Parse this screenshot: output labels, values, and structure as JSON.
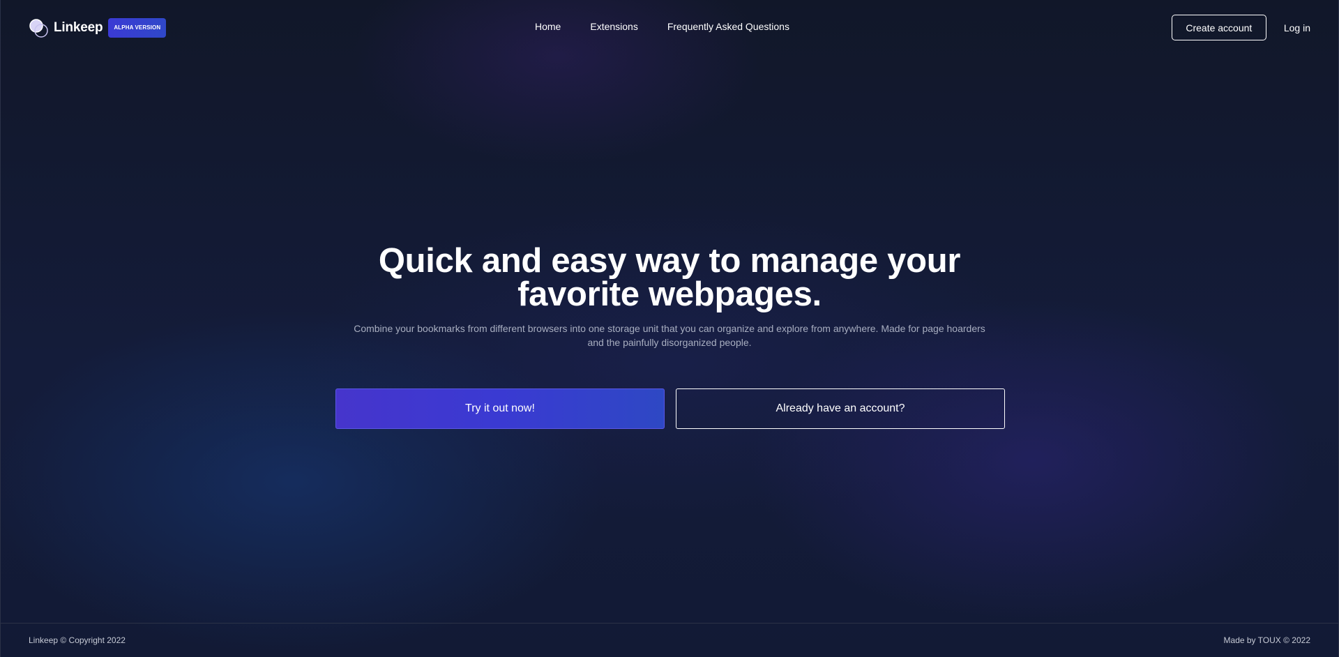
{
  "header": {
    "brand_name": "Linkeep",
    "badge": "ALPHA VERSION",
    "logo_icon": "linked-circles-icon",
    "nav": {
      "home": "Home",
      "extensions": "Extensions",
      "faq": "Frequently Asked Questions"
    },
    "create_account": "Create account",
    "login": "Log in"
  },
  "hero": {
    "title_line1": "Quick and easy way to manage your",
    "title_line2": "favorite webpages.",
    "subtitle": "Combine your bookmarks from different browsers into one storage unit that you can organize and explore from anywhere. Made for page hoarders and the painfully disorganized people.",
    "primary_cta": "Try it out now!",
    "secondary_cta": "Already have an account?"
  },
  "footer": {
    "left": "Linkeep © Copyright 2022",
    "right": "Made by TOUX © 2022"
  },
  "colors": {
    "background": "#111729",
    "accent": "#3b3ad4",
    "text": "#ffffff",
    "muted": "#a8aec0"
  }
}
